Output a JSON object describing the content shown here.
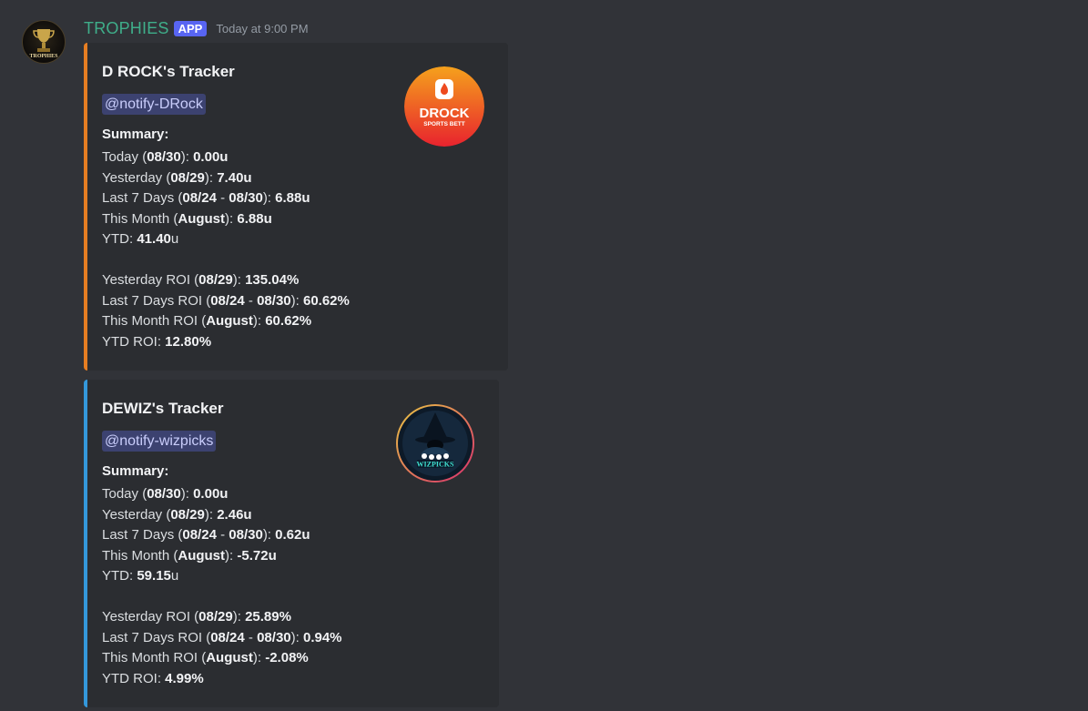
{
  "message": {
    "author": "TROPHIES",
    "badge": "APP",
    "timestamp": "Today at 9:00 PM",
    "avatar_icon": "trophy-icon",
    "avatar_text": "TROPHIES"
  },
  "embeds": [
    {
      "accent_color": "#e67e22",
      "title": "D ROCK's Tracker",
      "mention": "@notify-DRock",
      "summary_label": "Summary:",
      "thumbnail": {
        "icon": "drock-logo-icon",
        "text1": "DROCK",
        "text2": "SPORTS BETT"
      },
      "lines": [
        {
          "prefix": "Today (",
          "b1": "08/30",
          "mid": "): ",
          "b2": "0.00u",
          "suffix": ""
        },
        {
          "prefix": "Yesterday (",
          "b1": "08/29",
          "mid": "): ",
          "b2": "7.40u",
          "suffix": ""
        },
        {
          "prefix": "Last 7 Days (",
          "b1": "08/24",
          "mid": " - ",
          "b2": "08/30",
          "suffix": "): ",
          "b3": "6.88u"
        },
        {
          "prefix": "This Month (",
          "b1": "August",
          "mid": "): ",
          "b2": "6.88u",
          "suffix": ""
        },
        {
          "prefix": "YTD: ",
          "b1": "41.40",
          "mid": "u",
          "b2": "",
          "suffix": ""
        }
      ],
      "roi_lines": [
        {
          "prefix": "Yesterday ROI (",
          "b1": "08/29",
          "mid": "): ",
          "b2": "135.04%",
          "suffix": ""
        },
        {
          "prefix": "Last 7 Days ROI (",
          "b1": "08/24",
          "mid": " - ",
          "b2": "08/30",
          "suffix": "): ",
          "b3": "60.62%"
        },
        {
          "prefix": "This Month ROI (",
          "b1": "August",
          "mid": "): ",
          "b2": "60.62%",
          "suffix": ""
        },
        {
          "prefix": "YTD ROI: ",
          "b1": "12.80%",
          "mid": "",
          "b2": "",
          "suffix": ""
        }
      ]
    },
    {
      "accent_color": "#3498db",
      "title": "DEWIZ's Tracker",
      "mention": "@notify-wizpicks",
      "summary_label": "Summary:",
      "thumbnail": {
        "icon": "wizard-logo-icon",
        "text1": "WIZPICKS"
      },
      "lines": [
        {
          "prefix": "Today (",
          "b1": "08/30",
          "mid": "): ",
          "b2": "0.00u",
          "suffix": ""
        },
        {
          "prefix": "Yesterday (",
          "b1": "08/29",
          "mid": "): ",
          "b2": "2.46u",
          "suffix": ""
        },
        {
          "prefix": "Last 7 Days (",
          "b1": "08/24",
          "mid": " - ",
          "b2": "08/30",
          "suffix": "): ",
          "b3": "0.62u"
        },
        {
          "prefix": "This Month (",
          "b1": "August",
          "mid": "): ",
          "b2": "-5.72u",
          "suffix": ""
        },
        {
          "prefix": "YTD: ",
          "b1": "59.15",
          "mid": "u",
          "b2": "",
          "suffix": ""
        }
      ],
      "roi_lines": [
        {
          "prefix": "Yesterday ROI (",
          "b1": "08/29",
          "mid": "): ",
          "b2": "25.89%",
          "suffix": ""
        },
        {
          "prefix": "Last 7 Days ROI (",
          "b1": "08/24",
          "mid": " - ",
          "b2": "08/30",
          "suffix": "): ",
          "b3": "0.94%"
        },
        {
          "prefix": "This Month ROI (",
          "b1": "August",
          "mid": "): ",
          "b2": "-2.08%",
          "suffix": ""
        },
        {
          "prefix": "YTD ROI: ",
          "b1": "4.99%",
          "mid": "",
          "b2": "",
          "suffix": ""
        }
      ]
    }
  ]
}
